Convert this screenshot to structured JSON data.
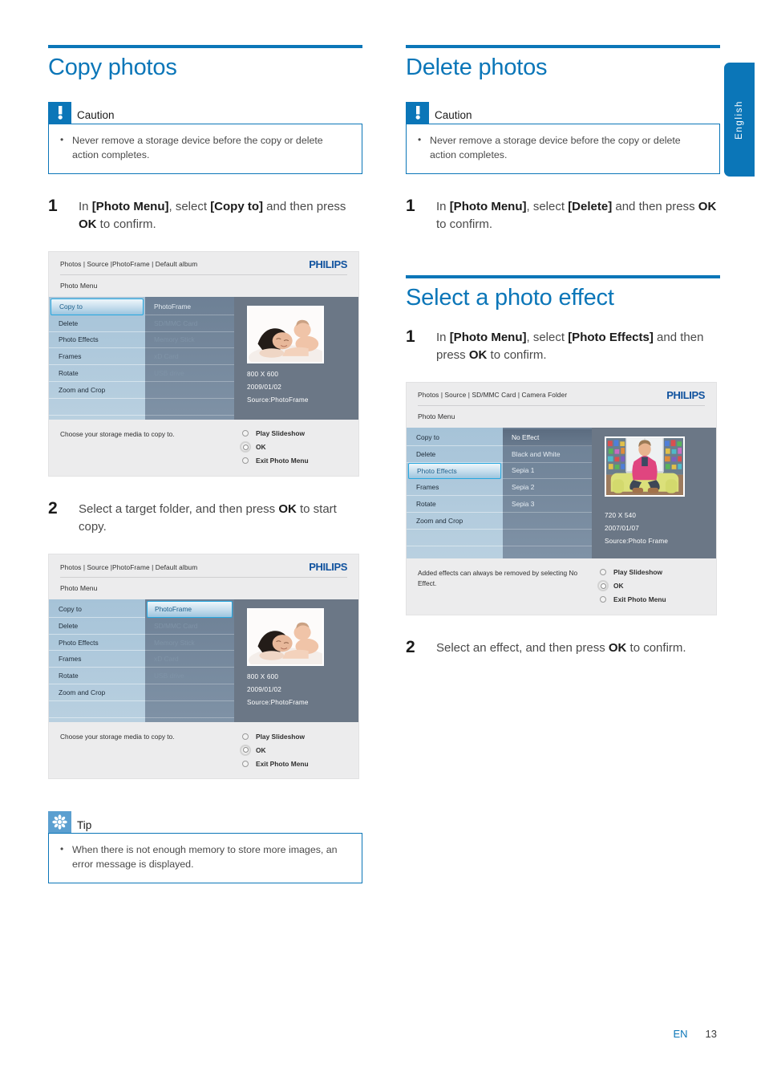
{
  "language_tab": {
    "label": "English"
  },
  "footer": {
    "lang_code": "EN",
    "page_number": "13"
  },
  "left_column": {
    "section": {
      "title": "Copy photos"
    },
    "caution": {
      "label": "Caution",
      "icon": "exclamation-icon",
      "items": [
        "Never remove a storage device before the copy or delete action completes."
      ]
    },
    "step1": {
      "number": "1",
      "text_parts": [
        "In ",
        "[Photo Menu]",
        ", select ",
        "[Copy to]",
        " and then press ",
        "OK",
        " to confirm."
      ]
    },
    "step2": {
      "number": "2",
      "text_parts": [
        "Select a target folder, and then press ",
        "OK",
        " to start copy."
      ]
    },
    "tip": {
      "label": "Tip",
      "icon": "asterisk-icon",
      "items": [
        "When there is not enough memory to store more images, an error message is displayed."
      ]
    }
  },
  "right_column": {
    "delete_section": {
      "title": "Delete photos"
    },
    "caution": {
      "label": "Caution",
      "icon": "exclamation-icon",
      "items": [
        "Never remove a storage device before the copy or delete action completes."
      ]
    },
    "delete_step1": {
      "number": "1",
      "text_parts": [
        "In ",
        "[Photo Menu]",
        ", select ",
        "[Delete]",
        " and then press ",
        "OK",
        " to confirm."
      ]
    },
    "effect_section": {
      "title": "Select a photo effect"
    },
    "effect_step1": {
      "number": "1",
      "text_parts": [
        "In ",
        "[Photo Menu]",
        ", select ",
        "[Photo Effects]",
        " and then press ",
        "OK",
        " to confirm."
      ]
    },
    "effect_step2": {
      "number": "2",
      "text_parts": [
        "Select an effect, and then press ",
        "OK",
        " to confirm."
      ]
    }
  },
  "screenshots": {
    "copy_step1": {
      "brand": "PHILIPS",
      "breadcrumb": "Photos | Source |PhotoFrame | Default album",
      "menu_title": "Photo Menu",
      "menu_items": [
        "Copy to",
        "Delete",
        "Photo Effects",
        "Frames",
        "Rotate",
        "Zoom and Crop"
      ],
      "selected_menu": "Copy to",
      "target_items": [
        "PhotoFrame",
        "SD/MMC Card",
        "Memory Stick",
        "xD Card",
        "USB drive"
      ],
      "target_enabled": [
        "PhotoFrame"
      ],
      "selected_target": "",
      "photo": {
        "resolution": "800 X 600",
        "date": "2009/01/02",
        "source": "Source:PhotoFrame"
      },
      "hint": "Choose your storage media to copy to.",
      "actions": [
        "Play Slideshow",
        "OK",
        "Exit Photo Menu"
      ],
      "active_action": "OK"
    },
    "copy_step2": {
      "brand": "PHILIPS",
      "breadcrumb": "Photos | Source |PhotoFrame | Default album",
      "menu_title": "Photo Menu",
      "menu_items": [
        "Copy to",
        "Delete",
        "Photo Effects",
        "Frames",
        "Rotate",
        "Zoom and Crop"
      ],
      "selected_menu": "",
      "target_items": [
        "PhotoFrame",
        "SD/MMC Card",
        "Memory Stick",
        "xD Card",
        "USB drive"
      ],
      "target_enabled": [
        "PhotoFrame"
      ],
      "selected_target": "PhotoFrame",
      "photo": {
        "resolution": "800 X 600",
        "date": "2009/01/02",
        "source": "Source:PhotoFrame"
      },
      "hint": "Choose your storage media to copy to.",
      "actions": [
        "Play Slideshow",
        "OK",
        "Exit Photo Menu"
      ],
      "active_action": "OK"
    },
    "photo_effects": {
      "brand": "PHILIPS",
      "breadcrumb": "Photos | Source | SD/MMC Card | Camera Folder",
      "menu_title": "Photo Menu",
      "menu_items": [
        "Copy to",
        "Delete",
        "Photo Effects",
        "Frames",
        "Rotate",
        "Zoom and Crop"
      ],
      "selected_menu": "Photo Effects",
      "effect_items": [
        "No Effect",
        "Black and White",
        "Sepia 1",
        "Sepia 2",
        "Sepia 3"
      ],
      "highlighted_effect": "No Effect",
      "photo": {
        "resolution": "720 X 540",
        "date": "2007/01/07",
        "source": "Source:Photo Frame"
      },
      "hint": "Added effects can always be removed by selecting No Effect.",
      "actions": [
        "Play Slideshow",
        "OK",
        "Exit Photo Menu"
      ],
      "active_action": "OK"
    }
  },
  "colors": {
    "brand_blue": "#0b76b8",
    "philips_blue": "#10529e",
    "tip_blue": "#5b9fd0",
    "pane_a": "#a6c3d8",
    "pane_b": "#6d8095",
    "pane_c": "#6b7786",
    "highlight_border": "#27a8e0"
  }
}
